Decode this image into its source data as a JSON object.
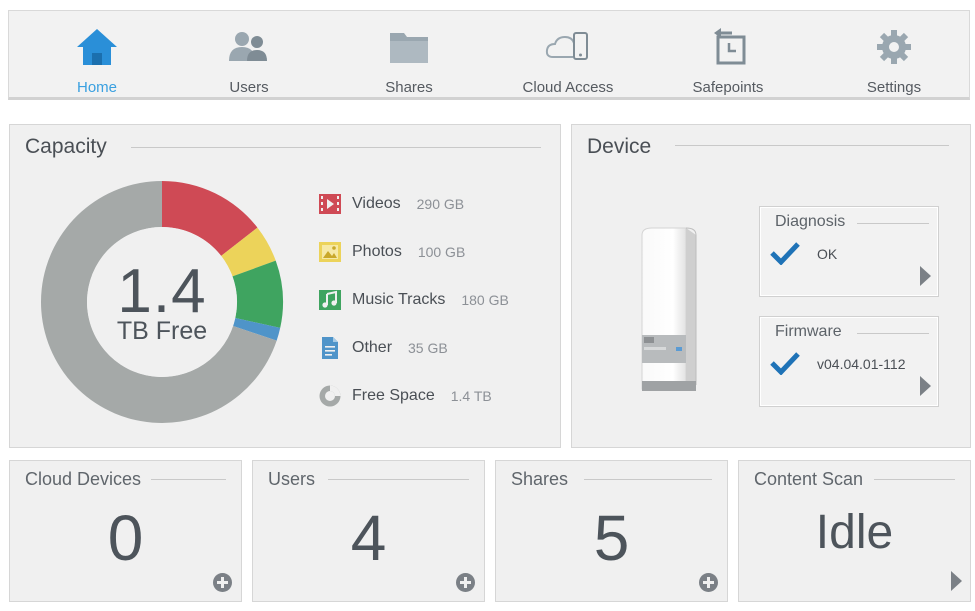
{
  "nav": {
    "items": [
      {
        "label": "Home",
        "icon": "home-icon",
        "active": true
      },
      {
        "label": "Users",
        "icon": "users-icon"
      },
      {
        "label": "Shares",
        "icon": "folder-icon"
      },
      {
        "label": "Cloud Access",
        "icon": "cloud-device-icon"
      },
      {
        "label": "Safepoints",
        "icon": "safepoint-icon"
      },
      {
        "label": "Settings",
        "icon": "gear-icon"
      }
    ],
    "active_color": "#3aa0e0"
  },
  "capacity": {
    "title": "Capacity",
    "center_value": "1.4",
    "center_label": "TB Free",
    "legend": [
      {
        "name": "Videos",
        "size": "290 GB",
        "icon": "video-icon",
        "color": "#cf4a55"
      },
      {
        "name": "Photos",
        "size": "100 GB",
        "icon": "photo-icon",
        "color": "#ecd35a"
      },
      {
        "name": "Music Tracks",
        "size": "180 GB",
        "icon": "music-icon",
        "color": "#3fa460"
      },
      {
        "name": "Other",
        "size": "35 GB",
        "icon": "document-icon",
        "color": "#4f94c9"
      },
      {
        "name": "Free Space",
        "size": "1.4 TB",
        "icon": "pie-icon",
        "color": "#a5a9a8"
      }
    ]
  },
  "device": {
    "title": "Device",
    "diagnosis": {
      "title": "Diagnosis",
      "value": "OK"
    },
    "firmware": {
      "title": "Firmware",
      "value": "v04.04.01-112"
    },
    "accent_color": "#1f73b7"
  },
  "stats": [
    {
      "title": "Cloud Devices",
      "value": "0",
      "action": "add"
    },
    {
      "title": "Users",
      "value": "4",
      "action": "add"
    },
    {
      "title": "Shares",
      "value": "5",
      "action": "add"
    },
    {
      "title": "Content Scan",
      "value": "Idle",
      "action": "details"
    }
  ]
}
